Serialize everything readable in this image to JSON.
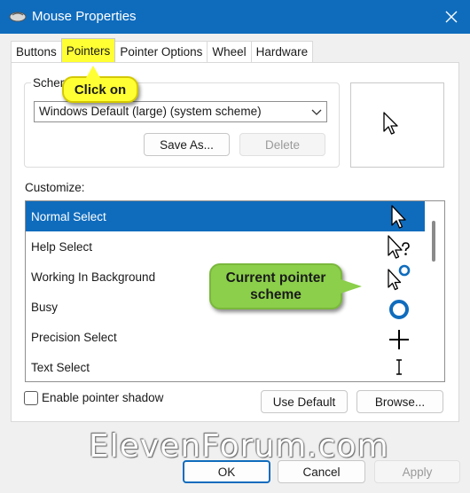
{
  "window": {
    "title": "Mouse Properties",
    "close_glyph": "✕"
  },
  "tabs": [
    {
      "label": "Buttons",
      "active": false
    },
    {
      "label": "Pointers",
      "active": true
    },
    {
      "label": "Pointer Options",
      "active": false
    },
    {
      "label": "Wheel",
      "active": false
    },
    {
      "label": "Hardware",
      "active": false
    }
  ],
  "scheme": {
    "group_label": "Scheme",
    "selected": "Windows Default (large) (system scheme)",
    "save_as_label": "Save As...",
    "delete_label": "Delete"
  },
  "customize": {
    "label": "Customize:",
    "rows": [
      {
        "label": "Normal Select",
        "icon": "arrow-cursor-icon",
        "selected": true
      },
      {
        "label": "Help Select",
        "icon": "help-cursor-icon",
        "selected": false
      },
      {
        "label": "Working In Background",
        "icon": "working-cursor-icon",
        "selected": false
      },
      {
        "label": "Busy",
        "icon": "busy-ring-icon",
        "selected": false
      },
      {
        "label": "Precision Select",
        "icon": "crosshair-icon",
        "selected": false
      },
      {
        "label": "Text Select",
        "icon": "ibeam-icon",
        "selected": false
      }
    ]
  },
  "shadow": {
    "label": "Enable pointer shadow",
    "checked": false
  },
  "buttons": {
    "use_default": "Use Default",
    "browse": "Browse...",
    "ok": "OK",
    "cancel": "Cancel",
    "apply": "Apply"
  },
  "annotations": {
    "click_on": "Click on",
    "current_scheme": "Current pointer scheme"
  },
  "watermark": "ElevenForum.com",
  "colors": {
    "accent": "#0f6cbd",
    "highlight": "#ffff33",
    "callout_green": "#8bcf4a"
  }
}
